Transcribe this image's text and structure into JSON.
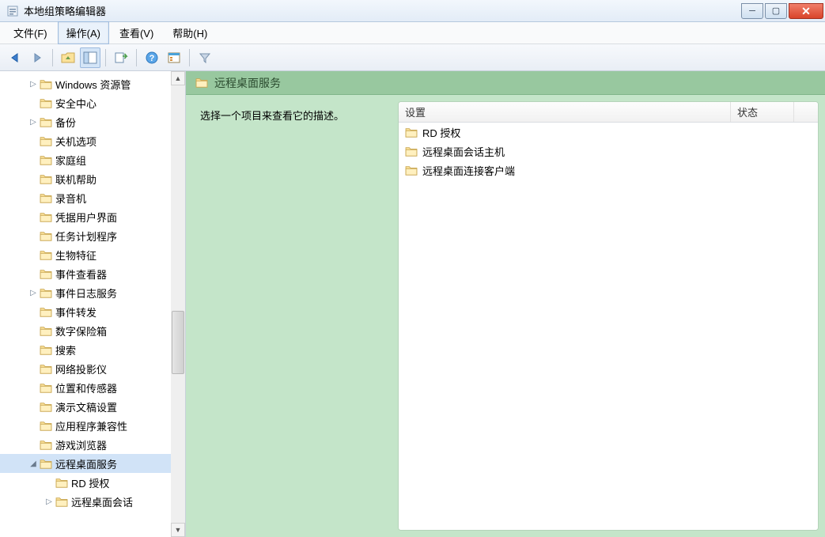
{
  "window": {
    "title": "本地组策略编辑器"
  },
  "menubar": {
    "file": "文件(F)",
    "action": "操作(A)",
    "view": "查看(V)",
    "help": "帮助(H)"
  },
  "tree": {
    "items": [
      {
        "label": "Windows 资源管",
        "indent": 36,
        "expander": "▷"
      },
      {
        "label": "安全中心",
        "indent": 36,
        "expander": ""
      },
      {
        "label": "备份",
        "indent": 36,
        "expander": "▷"
      },
      {
        "label": "关机选项",
        "indent": 36,
        "expander": ""
      },
      {
        "label": "家庭组",
        "indent": 36,
        "expander": ""
      },
      {
        "label": "联机帮助",
        "indent": 36,
        "expander": ""
      },
      {
        "label": "录音机",
        "indent": 36,
        "expander": ""
      },
      {
        "label": "凭据用户界面",
        "indent": 36,
        "expander": ""
      },
      {
        "label": "任务计划程序",
        "indent": 36,
        "expander": ""
      },
      {
        "label": "生物特征",
        "indent": 36,
        "expander": ""
      },
      {
        "label": "事件查看器",
        "indent": 36,
        "expander": ""
      },
      {
        "label": "事件日志服务",
        "indent": 36,
        "expander": "▷"
      },
      {
        "label": "事件转发",
        "indent": 36,
        "expander": ""
      },
      {
        "label": "数字保险箱",
        "indent": 36,
        "expander": ""
      },
      {
        "label": "搜索",
        "indent": 36,
        "expander": ""
      },
      {
        "label": "网络投影仪",
        "indent": 36,
        "expander": ""
      },
      {
        "label": "位置和传感器",
        "indent": 36,
        "expander": ""
      },
      {
        "label": "演示文稿设置",
        "indent": 36,
        "expander": ""
      },
      {
        "label": "应用程序兼容性",
        "indent": 36,
        "expander": ""
      },
      {
        "label": "游戏浏览器",
        "indent": 36,
        "expander": ""
      },
      {
        "label": "远程桌面服务",
        "indent": 36,
        "expander": "◢",
        "selected": true
      },
      {
        "label": "RD 授权",
        "indent": 56,
        "expander": ""
      },
      {
        "label": "远程桌面会话",
        "indent": 56,
        "expander": "▷"
      }
    ]
  },
  "detail": {
    "header": "远程桌面服务",
    "description": "选择一个项目来查看它的描述。",
    "columns": {
      "setting": "设置",
      "status": "状态"
    },
    "items": [
      {
        "label": "RD 授权"
      },
      {
        "label": "远程桌面会话主机"
      },
      {
        "label": "远程桌面连接客户端"
      }
    ]
  }
}
